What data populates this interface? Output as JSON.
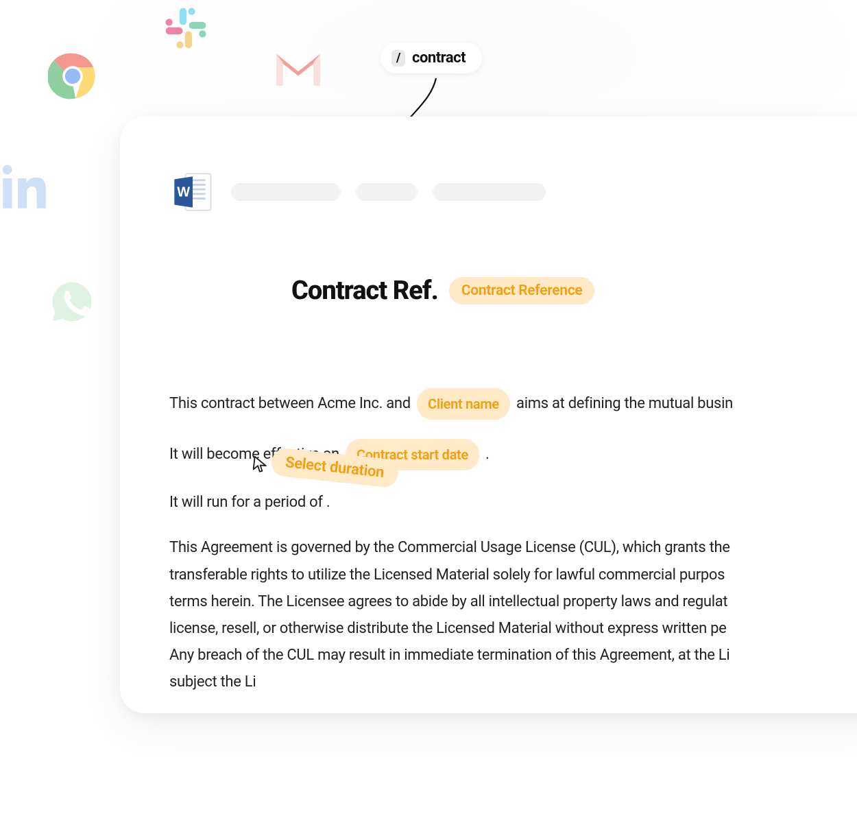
{
  "slash": {
    "key": "/",
    "command": "contract"
  },
  "document": {
    "title": "Contract Ref.",
    "titleToken": "Contract Reference",
    "body": {
      "line1_prefix": "This contract between Acme Inc. and ",
      "line1_token": "Client name",
      "line1_suffix": " aims at defining the mutual busin",
      "line2_prefix": "It will become effective on ",
      "line2_token": "Contract start date",
      "line2_suffix": " .",
      "line3": "It will run for a period of  .",
      "para4_l1": "This Agreement is governed by the Commercial Usage License (CUL), which grants the",
      "para4_l2": "transferable rights to utilize the Licensed Material solely for lawful commercial purpos",
      "para4_l3": "terms herein. The Licensee agrees to abide by all intellectual property laws and regulat",
      "para4_l4": "license, resell, or otherwise distribute the Licensed Material without express written pe",
      "para4_l5": "Any breach of the CUL may result in immediate termination of this Agreement, at the Li",
      "para4_l6": "subject the Li"
    }
  },
  "overlay": {
    "selectDuration": "Select duration"
  },
  "icons": {
    "slack": "slack-icon",
    "chrome": "chrome-icon",
    "gmail": "gmail-icon",
    "linkedin": "linkedin-icon",
    "whatsapp": "whatsapp-icon",
    "word": "ms-word-icon",
    "cursor": "cursor-icon"
  },
  "colors": {
    "tokenBg": "#ffe9c7",
    "tokenText": "#f59e0b"
  }
}
